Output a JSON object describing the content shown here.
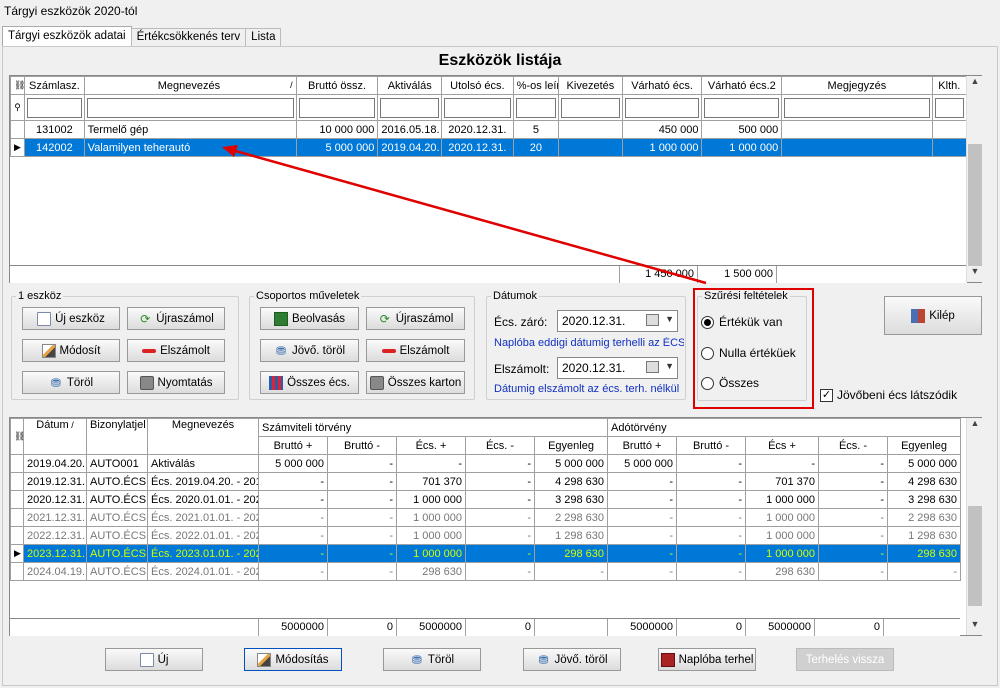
{
  "window": {
    "title": "Tárgyi eszközök 2020-tól"
  },
  "tabs": [
    "Tárgyi eszközök adatai",
    "Értékcsökkenés terv",
    "Lista"
  ],
  "list_title": "Eszközök listája",
  "assets": {
    "columns": [
      "Számlasz.",
      "Megnevezés",
      "Bruttó össz.",
      "Aktiválás",
      "Utolsó écs.",
      "%-os leír.",
      "Kivezetés",
      "Várható écs.",
      "Várható écs.2",
      "Megjegyzés",
      "Klth."
    ],
    "rows": [
      [
        "131002",
        "Termelő gép",
        "10 000 000",
        "2016.05.18.",
        "2020.12.31.",
        "5",
        "",
        "450 000",
        "500 000",
        "",
        ""
      ],
      [
        "142002",
        "Valamilyen teherautó",
        "5 000 000",
        "2019.04.20.",
        "2020.12.31.",
        "20",
        "",
        "1 000 000",
        "1 000 000",
        "",
        ""
      ]
    ],
    "totals": {
      "varhato": "1 450 000",
      "varhato2": "1 500 000"
    }
  },
  "group_one": {
    "title": "1 eszköz",
    "buttons": [
      "Új eszköz",
      "Újraszámol",
      "Módosít",
      "Elszámolt",
      "Töröl",
      "Nyomtatás"
    ]
  },
  "group_ops": {
    "title": "Csoportos műveletek",
    "buttons": [
      "Beolvasás",
      "Újraszámol",
      "Jövő. töröl",
      "Elszámolt",
      "Összes écs.",
      "Összes karton"
    ]
  },
  "dates": {
    "title": "Dátumok",
    "ecs_label": "Écs. záró:",
    "ecs_value": "2020.12.31.",
    "ecs_note": "Naplóba eddigi dátumig terhelli az ÉCS-t",
    "elsz_label": "Elszámolt:",
    "elsz_value": "2020.12.31.",
    "elsz_note": "Dátumig elszámolt az écs. terh. nélkül"
  },
  "filters": {
    "title": "Szűrési feltételek",
    "options": [
      "Értékük van",
      "Nulla értéküek",
      "Összes"
    ],
    "selected": 0,
    "checkbox_label": "Jövőbeni écs látszódik",
    "checkbox_checked": true,
    "accent": "#e00000"
  },
  "exit_label": "Kilép",
  "ledger": {
    "headers": [
      "Dátum",
      "Bizonylatjel",
      "Megnevezés"
    ],
    "group1": "Számviteli törvény",
    "group2": "Adótörvény",
    "subheaders": [
      "Bruttó +",
      "Bruttó -",
      "Écs. +",
      "Écs. -",
      "Egyenleg",
      "Bruttó +",
      "Bruttó -",
      "Écs +",
      "Écs. -",
      "Egyenleg"
    ],
    "rows": [
      [
        "2019.04.20.",
        "AUTO001",
        "Aktiválás",
        "5 000 000",
        "-",
        "-",
        "-",
        "5 000 000",
        "5 000 000",
        "-",
        "-",
        "-",
        "5 000 000"
      ],
      [
        "2019.12.31.",
        "AUTO.ÉCS",
        "Écs. 2019.04.20. - 201",
        "-",
        "-",
        "701 370",
        "-",
        "4 298 630",
        "-",
        "-",
        "701 370",
        "-",
        "4 298 630"
      ],
      [
        "2020.12.31.",
        "AUTO.ÉCS",
        "Écs. 2020.01.01. - 202",
        "-",
        "-",
        "1 000 000",
        "-",
        "3 298 630",
        "-",
        "-",
        "1 000 000",
        "-",
        "3 298 630"
      ],
      [
        "2021.12.31.",
        "AUTO.ÉCS",
        "Écs. 2021.01.01. - 202",
        "-",
        "-",
        "1 000 000",
        "-",
        "2 298 630",
        "-",
        "-",
        "1 000 000",
        "-",
        "2 298 630"
      ],
      [
        "2022.12.31.",
        "AUTO.ÉCS",
        "Écs. 2022.01.01. - 202",
        "-",
        "-",
        "1 000 000",
        "-",
        "1 298 630",
        "-",
        "-",
        "1 000 000",
        "-",
        "1 298 630"
      ],
      [
        "2023.12.31.",
        "AUTO.ÉCS",
        "Écs. 2023.01.01. - 202",
        "-",
        "-",
        "1 000 000",
        "-",
        "298 630",
        "-",
        "-",
        "1 000 000",
        "-",
        "298 630"
      ],
      [
        "2024.04.19.",
        "AUTO.ÉCS",
        "Écs. 2024.01.01. - 202",
        "-",
        "-",
        "298 630",
        "-",
        "-",
        "-",
        "-",
        "298 630",
        "-",
        "-"
      ]
    ],
    "totals": [
      "5000000",
      "0",
      "5000000",
      "0",
      "",
      "5000000",
      "0",
      "5000000",
      "0",
      ""
    ]
  },
  "bottom_buttons": [
    "Új",
    "Módosítás",
    "Töröl",
    "Jövő. töröl",
    "Naplóba terhel",
    "Terhelés vissza"
  ]
}
